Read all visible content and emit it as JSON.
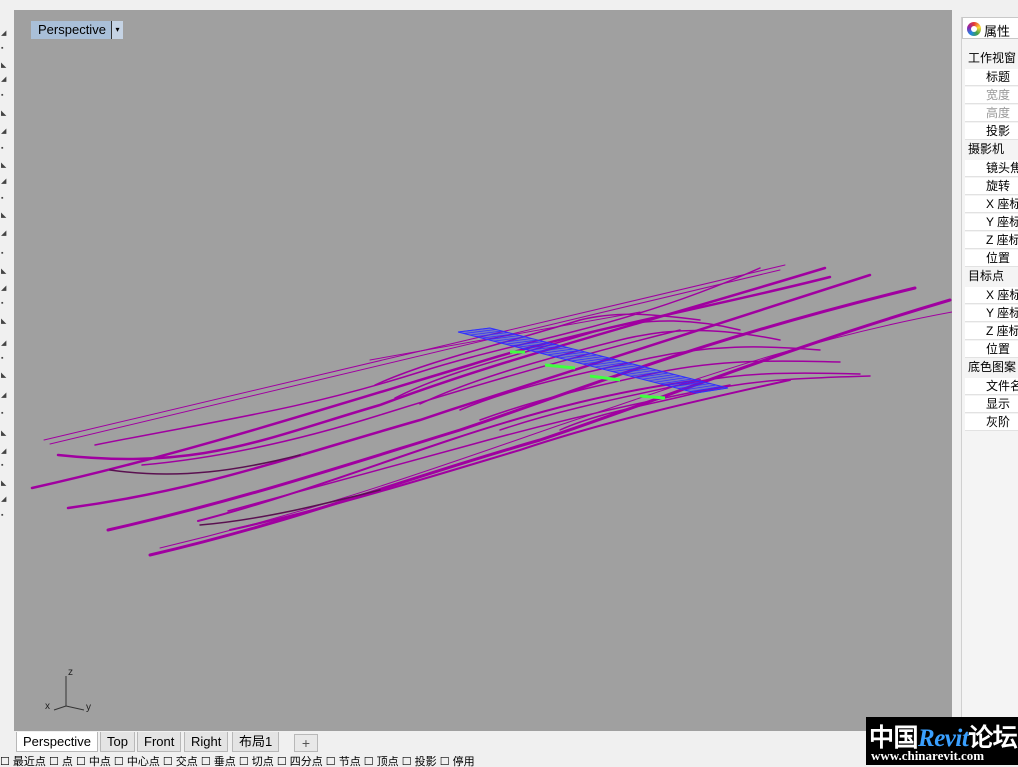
{
  "viewport": {
    "title": "Perspective",
    "dropdown_glyph": "▾",
    "axis": {
      "z": "z",
      "x": "x",
      "y": "y"
    }
  },
  "view_tabs": [
    "Perspective",
    "Top",
    "Front",
    "Right",
    "布局1"
  ],
  "add_tab_glyph": "+",
  "osnap_text": "☐ 最近点 ☐ 点 ☐ 中点 ☐ 中心点 ☐ 交点 ☐ 垂点 ☐ 切点 ☐ 四分点 ☐ 节点 ☐ 顶点 ☐ 投影 ☐ 停用",
  "properties_panel": {
    "tab_label": "属性",
    "tab_icon": "color-wheel-icon",
    "rows": [
      {
        "label": "工作视窗",
        "kind": "section"
      },
      {
        "label": "标题",
        "kind": "item"
      },
      {
        "label": "宽度",
        "kind": "item",
        "disabled": true
      },
      {
        "label": "高度",
        "kind": "item",
        "disabled": true
      },
      {
        "label": "投影",
        "kind": "item"
      },
      {
        "label": "摄影机",
        "kind": "section"
      },
      {
        "label": "镜头焦",
        "kind": "item"
      },
      {
        "label": "旋转",
        "kind": "item"
      },
      {
        "label": "X 座标",
        "kind": "item"
      },
      {
        "label": "Y 座标",
        "kind": "item"
      },
      {
        "label": "Z 座标",
        "kind": "item"
      },
      {
        "label": "位置",
        "kind": "item"
      },
      {
        "label": "目标点",
        "kind": "section"
      },
      {
        "label": "X 座标",
        "kind": "item"
      },
      {
        "label": "Y 座标",
        "kind": "item"
      },
      {
        "label": "Z 座标",
        "kind": "item"
      },
      {
        "label": "位置",
        "kind": "item"
      },
      {
        "label": "底色图案",
        "kind": "section"
      },
      {
        "label": "文件名",
        "kind": "item"
      },
      {
        "label": "显示",
        "kind": "item"
      },
      {
        "label": "灰阶",
        "kind": "item"
      }
    ]
  },
  "watermark": {
    "prefix": "中国",
    "brand": "Revit",
    "suffix": "论坛",
    "url": "www.chinarevit.com"
  },
  "colors": {
    "viewport_bg": "#a0a0a0",
    "curve": "#a000a0",
    "curve_dark": "#4a1040",
    "grid": "#3030ff",
    "highlight": "#40ff40"
  }
}
